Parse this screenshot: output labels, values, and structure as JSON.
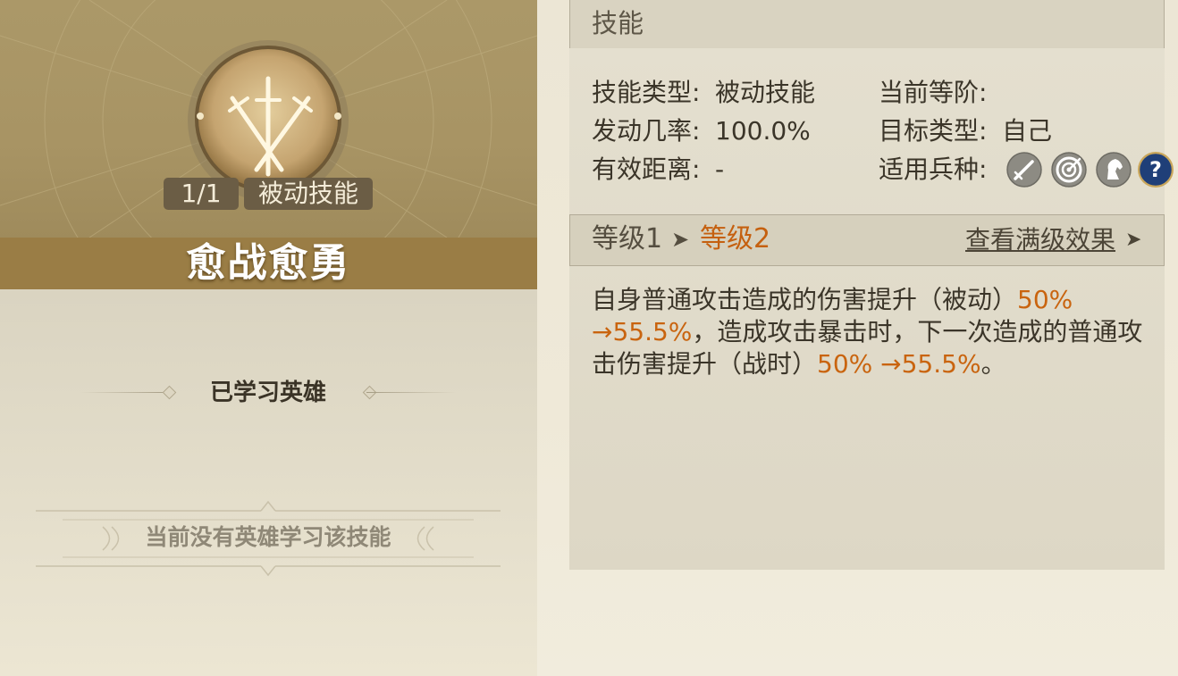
{
  "skill": {
    "name": "愈战愈勇",
    "count": "1/1",
    "type_badge": "被动技能",
    "icon": "crossed-swords-icon"
  },
  "left": {
    "learned_title": "已学习英雄",
    "no_hero_text": "当前没有英雄学习该技能"
  },
  "header": {
    "title": "技能"
  },
  "info": {
    "skill_type_label": "技能类型:",
    "skill_type_value": "被动技能",
    "current_rank_label": "当前等阶:",
    "current_rank_value": "",
    "trigger_rate_label": "发动几率:",
    "trigger_rate_value": "100.0%",
    "target_type_label": "目标类型:",
    "target_type_value": "自己",
    "range_label": "有效距离:",
    "range_value": "-",
    "troop_label": "适用兵种:",
    "troop_icons": [
      "infantry-sword-icon",
      "archer-target-icon",
      "cavalry-horse-icon",
      "question-mark-icon"
    ]
  },
  "level": {
    "current": "等级1",
    "arrow": "➤",
    "next": "等级2",
    "view_max": "查看满级效果",
    "view_arrow": "➤"
  },
  "description": {
    "p1": "自身普通攻击造成的伤害提升（被动）",
    "v1": "50% →55.5%",
    "p2": "，造成攻击暴击时，下一次造成的普通攻击伤害提升（战时）",
    "v2": "50% →55.5%",
    "p3": "。"
  },
  "colors": {
    "highlight": "#c9640f",
    "title_band": "#9a7d45",
    "panel_top": "#a89464"
  }
}
